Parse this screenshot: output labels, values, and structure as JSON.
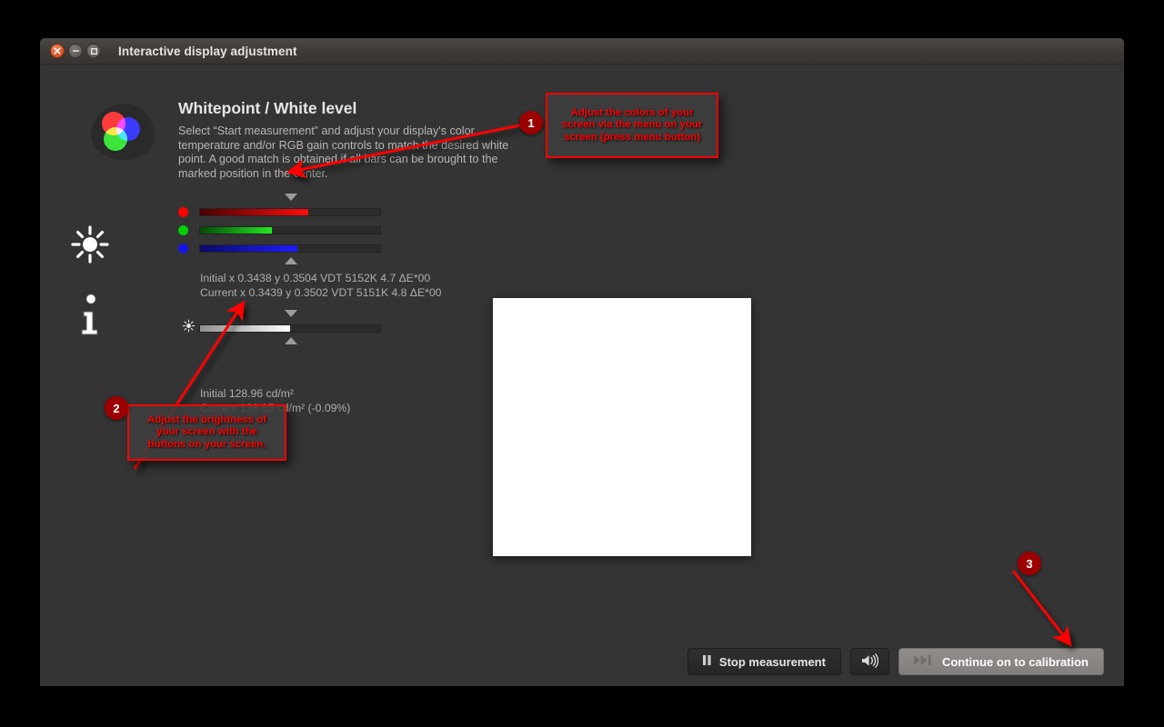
{
  "window": {
    "title": "Interactive display adjustment",
    "controls": [
      {
        "name": "close",
        "glyph": "×"
      },
      {
        "name": "minimize",
        "glyph": "−"
      },
      {
        "name": "maximize",
        "glyph": "□"
      }
    ]
  },
  "rail": {
    "logo_label": "rgb-logo",
    "icons": [
      {
        "name": "brightness-sun-icon"
      },
      {
        "name": "info-icon"
      }
    ]
  },
  "main": {
    "heading": "Whitepoint / White level",
    "description": "Select “Start measurement” and adjust your display's color temperature and/or RGB gain controls to match the desired white point. A good match is obtained if all bars can be brought to the marked position in the center.",
    "rgb_sliders": [
      {
        "channel": "red",
        "name": "red-level-slider",
        "fill_percent": 60
      },
      {
        "channel": "green",
        "name": "green-level-slider",
        "fill_percent": 40
      },
      {
        "channel": "blue",
        "name": "blue-level-slider",
        "fill_percent": 54
      }
    ],
    "rgb_readout": {
      "initial": "Initial x 0.3438 y 0.3504 VDT 5152K 4.7 ΔE*00",
      "current": "Current x 0.3439 y 0.3502 VDT 5151K 4.8 ΔE*00"
    },
    "brightness_slider": {
      "name": "brightness-slider",
      "fill_percent": 50
    },
    "luminance_readout": {
      "initial": "Initial 128.96 cd/m²",
      "current": "Current 128.85 cd/m² (-0.09%)"
    },
    "measurement_patch": {
      "color": "#ffffff"
    }
  },
  "footer": {
    "stop_button": {
      "label": "Stop measurement",
      "glyph": "▐▌"
    },
    "sound_button": {
      "label": "🔊"
    },
    "continue_button": {
      "label": "Continue on to calibration",
      "glyph": "▶▶❘"
    }
  },
  "annotations": [
    {
      "number": "1",
      "text": "Adjust the colors of your screen via the menu on your screen (press menu button)"
    },
    {
      "number": "2",
      "text": "Adjust the brightness of your screen with the buttons on your screen."
    },
    {
      "number": "3",
      "text": ""
    }
  ],
  "colors": {
    "annotation_red": "#ff0000",
    "badge_red": "#9c0000",
    "window_bg": "#343434"
  }
}
